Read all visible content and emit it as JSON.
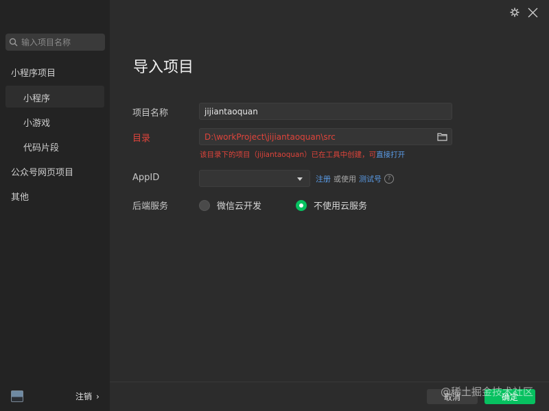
{
  "sidebar": {
    "search_placeholder": "输入项目名称",
    "items": [
      {
        "label": "小程序项目"
      },
      {
        "label": "小程序"
      },
      {
        "label": "小游戏"
      },
      {
        "label": "代码片段"
      },
      {
        "label": "公众号网页项目"
      },
      {
        "label": "其他"
      }
    ],
    "logout_label": "注销",
    "logout_arrow": "›"
  },
  "main": {
    "title": "导入项目",
    "project_name_label": "项目名称",
    "project_name_value": "jijiantaoquan",
    "dir_label": "目录",
    "dir_value": "D:\\workProject\\jijiantaoquan\\src",
    "hint_prefix": "该目录下的项目（",
    "hint_project": "jijiantaoquan",
    "hint_middle": "）已在工具中创建，可",
    "hint_link": "直接打开",
    "appid_label": "AppID",
    "appid_value": "",
    "register_link": "注册",
    "or_use_text": "或使用",
    "test_id_link": "测试号",
    "help_glyph": "?",
    "backend_label": "后端服务",
    "radio_option_1": "微信云开发",
    "radio_option_2": "不使用云服务"
  },
  "footer": {
    "cancel_label": "取消",
    "ok_label": "确定",
    "watermark": "@稀土掘金技术社区"
  },
  "colors": {
    "accent_green": "#07c160",
    "error_red": "#e0443b",
    "link_blue": "#5a9be6"
  }
}
